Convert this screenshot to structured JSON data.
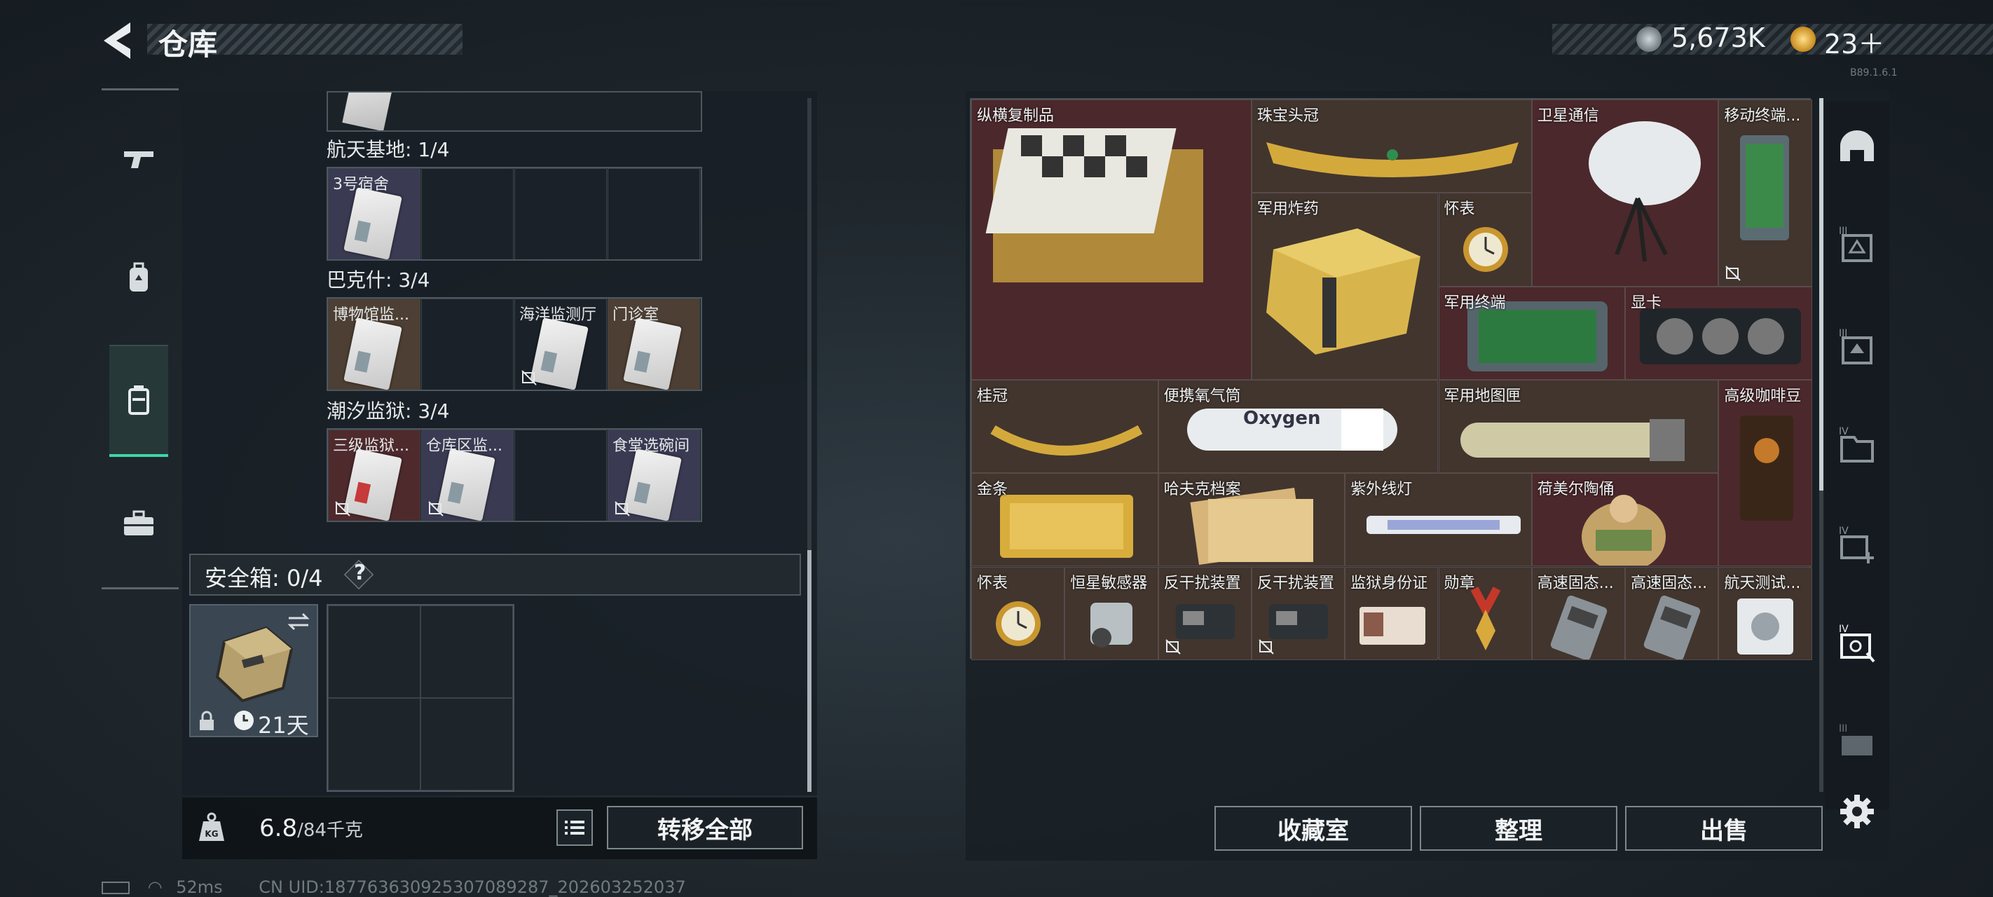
{
  "header": {
    "title": "仓库",
    "currency_primary": "5,673K",
    "currency_secondary": "23＋",
    "version": "B89.1.6.1"
  },
  "left_nav": {
    "items": [
      {
        "name": "weapons",
        "icon": "gun-icon"
      },
      {
        "name": "equipment",
        "icon": "backpack-icon"
      },
      {
        "name": "containers",
        "icon": "container-icon",
        "active": true
      },
      {
        "name": "supplies",
        "icon": "briefcase-icon"
      }
    ]
  },
  "left_panel": {
    "groups": [
      {
        "label": "航天基地: 1/4",
        "cells": [
          {
            "name": "3号宿舍",
            "bg": "purple",
            "card": true,
            "nodrop": false
          },
          {
            "name": "",
            "bg": "",
            "card": false,
            "nodrop": false
          },
          {
            "name": "",
            "bg": "",
            "card": false,
            "nodrop": false
          },
          {
            "name": "",
            "bg": "",
            "card": false,
            "nodrop": false
          }
        ]
      },
      {
        "label": "巴克什: 3/4",
        "cells": [
          {
            "name": "博物馆监...",
            "bg": "brown",
            "card": true,
            "nodrop": false
          },
          {
            "name": "",
            "bg": "",
            "card": false,
            "nodrop": false
          },
          {
            "name": "海洋监测厅",
            "bg": "",
            "card": true,
            "nodrop": true
          },
          {
            "name": "门诊室",
            "bg": "brown",
            "card": true,
            "nodrop": false
          }
        ]
      },
      {
        "label": "潮汐监狱: 3/4",
        "cells": [
          {
            "name": "三级监狱...",
            "bg": "maroon",
            "card": true,
            "red": true,
            "nodrop": true
          },
          {
            "name": "仓库区监...",
            "bg": "purple",
            "card": true,
            "nodrop": true
          },
          {
            "name": "",
            "bg": "",
            "card": false,
            "nodrop": false
          },
          {
            "name": "食堂选碗间",
            "bg": "purple",
            "card": true,
            "nodrop": true
          }
        ]
      }
    ],
    "safe_box": {
      "label": "安全箱: 0/4",
      "help": "?",
      "timer": "21天"
    },
    "weight_value": "6.8",
    "weight_capacity": "/84千克",
    "transfer_all": "转移全部"
  },
  "right_panel": {
    "items": [
      {
        "name": "纵横复制品",
        "col": 0,
        "row": 0,
        "w": 3,
        "h": 3,
        "bg": "m",
        "art": "chess"
      },
      {
        "name": "珠宝头冠",
        "col": 3,
        "row": 0,
        "w": 3,
        "h": 1,
        "bg": "b",
        "art": "crown"
      },
      {
        "name": "卫星通信",
        "col": 6,
        "row": 0,
        "w": 2,
        "h": 2,
        "bg": "m",
        "art": "dish"
      },
      {
        "name": "移动终端...",
        "col": 8,
        "row": 0,
        "w": 1,
        "h": 2,
        "bg": "b",
        "art": "tablet",
        "nodrop": true
      },
      {
        "name": "军用炸药",
        "col": 3,
        "row": 1,
        "w": 2,
        "h": 2,
        "bg": "b",
        "art": "crate"
      },
      {
        "name": "怀表",
        "col": 5,
        "row": 1,
        "w": 1,
        "h": 1,
        "bg": "b",
        "art": "watch"
      },
      {
        "name": "军用终端",
        "col": 5,
        "row": 2,
        "w": 2,
        "h": 1,
        "bg": "m",
        "art": "terminal"
      },
      {
        "name": "显卡",
        "col": 7,
        "row": 2,
        "w": 2,
        "h": 1,
        "bg": "m",
        "art": "gpu"
      },
      {
        "name": "桂冠",
        "col": 0,
        "row": 3,
        "w": 2,
        "h": 1,
        "bg": "b",
        "art": "laurel"
      },
      {
        "name": "便携氧气筒",
        "col": 2,
        "row": 3,
        "w": 3,
        "h": 1,
        "bg": "b",
        "art": "oxygen"
      },
      {
        "name": "军用地图匣",
        "col": 5,
        "row": 3,
        "w": 3,
        "h": 1,
        "bg": "b",
        "art": "tube"
      },
      {
        "name": "高级咖啡豆",
        "col": 8,
        "row": 3,
        "w": 1,
        "h": 2,
        "bg": "m",
        "art": "coffee"
      },
      {
        "name": "金条",
        "col": 0,
        "row": 4,
        "w": 2,
        "h": 1,
        "bg": "b",
        "art": "gold"
      },
      {
        "name": "哈夫克档案",
        "col": 2,
        "row": 4,
        "w": 2,
        "h": 1,
        "bg": "b",
        "art": "files"
      },
      {
        "name": "紫外线灯",
        "col": 4,
        "row": 4,
        "w": 2,
        "h": 1,
        "bg": "b",
        "art": "uvlamp"
      },
      {
        "name": "荷美尔陶俑",
        "col": 6,
        "row": 4,
        "w": 2,
        "h": 1,
        "bg": "m",
        "art": "figure"
      },
      {
        "name": "怀表",
        "col": 0,
        "row": 5,
        "w": 1,
        "h": 1,
        "bg": "b",
        "art": "watch"
      },
      {
        "name": "恒星敏感器",
        "col": 1,
        "row": 5,
        "w": 1,
        "h": 1,
        "bg": "b",
        "art": "sensor"
      },
      {
        "name": "反干扰装置",
        "col": 2,
        "row": 5,
        "w": 1,
        "h": 1,
        "bg": "b",
        "art": "device",
        "nodrop": true
      },
      {
        "name": "反干扰装置",
        "col": 3,
        "row": 5,
        "w": 1,
        "h": 1,
        "bg": "b",
        "art": "device",
        "nodrop": true
      },
      {
        "name": "监狱身份证",
        "col": 4,
        "row": 5,
        "w": 1,
        "h": 1,
        "bg": "b",
        "art": "idcard"
      },
      {
        "name": "勋章",
        "col": 5,
        "row": 5,
        "w": 1,
        "h": 1,
        "bg": "b",
        "art": "medal"
      },
      {
        "name": "高速固态...",
        "col": 6,
        "row": 5,
        "w": 1,
        "h": 1,
        "bg": "b",
        "art": "ssd"
      },
      {
        "name": "高速固态...",
        "col": 7,
        "row": 5,
        "w": 1,
        "h": 1,
        "bg": "b",
        "art": "ssd"
      },
      {
        "name": "航天测试...",
        "col": 8,
        "row": 5,
        "w": 1,
        "h": 1,
        "bg": "b",
        "art": "disk"
      }
    ],
    "buttons": {
      "collection": "收藏室",
      "organize": "整理",
      "sell": "出售"
    }
  },
  "right_nav": {
    "items": [
      "helmet-icon",
      "tier3-box-icon",
      "tier3-box2-icon",
      "tier4-box-icon",
      "tier4-add-icon",
      "tier4-safe-icon",
      "tier3-case-icon",
      "settings-icon"
    ]
  },
  "status_bar": {
    "ping": "52ms",
    "uid": "CN UID:18776363092530708928​7_202603252037"
  }
}
